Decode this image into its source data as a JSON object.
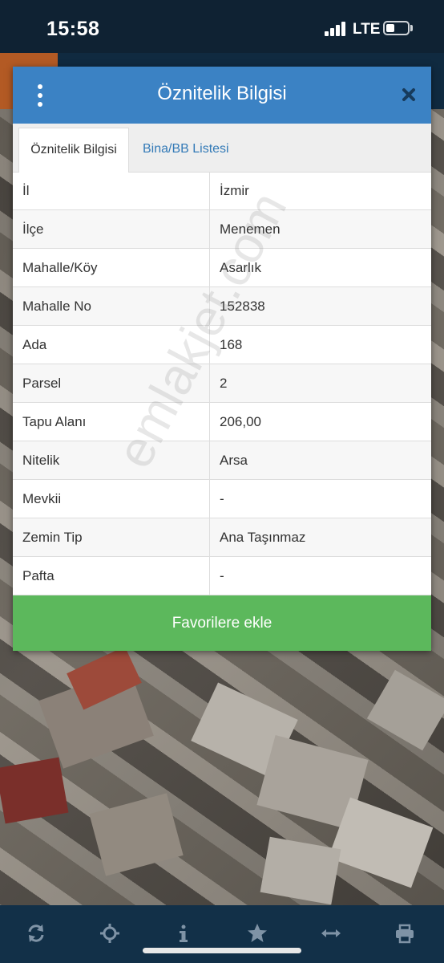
{
  "status_bar": {
    "time": "15:58",
    "network": "LTE"
  },
  "modal": {
    "title": "Öznitelik Bilgisi",
    "menu_icon": "kebab-menu-icon",
    "close_icon": "close-icon",
    "tabs": [
      {
        "label": "Öznitelik Bilgisi",
        "active": true
      },
      {
        "label": "Bina/BB Listesi",
        "active": false
      }
    ],
    "rows": [
      {
        "key": "İl",
        "value": "İzmir"
      },
      {
        "key": "İlçe",
        "value": "Menemen"
      },
      {
        "key": "Mahalle/Köy",
        "value": "Asarlık"
      },
      {
        "key": "Mahalle No",
        "value": "152838"
      },
      {
        "key": "Ada",
        "value": "168"
      },
      {
        "key": "Parsel",
        "value": "2"
      },
      {
        "key": "Tapu Alanı",
        "value": "206,00"
      },
      {
        "key": "Nitelik",
        "value": "Arsa"
      },
      {
        "key": "Mevkii",
        "value": "-"
      },
      {
        "key": "Zemin Tip",
        "value": "Ana Taşınmaz"
      },
      {
        "key": "Pafta",
        "value": "-"
      }
    ],
    "favorite_button": "Favorilere ekle"
  },
  "watermark": "emlakjet.com",
  "bottom_bar": {
    "icons": [
      "refresh-icon",
      "locate-icon",
      "info-icon",
      "star-icon",
      "measure-icon",
      "print-icon"
    ]
  },
  "colors": {
    "header": "#3b82c4",
    "favorite_button": "#5cb85c",
    "link": "#337ab7",
    "bottom_bar": "#123048"
  }
}
